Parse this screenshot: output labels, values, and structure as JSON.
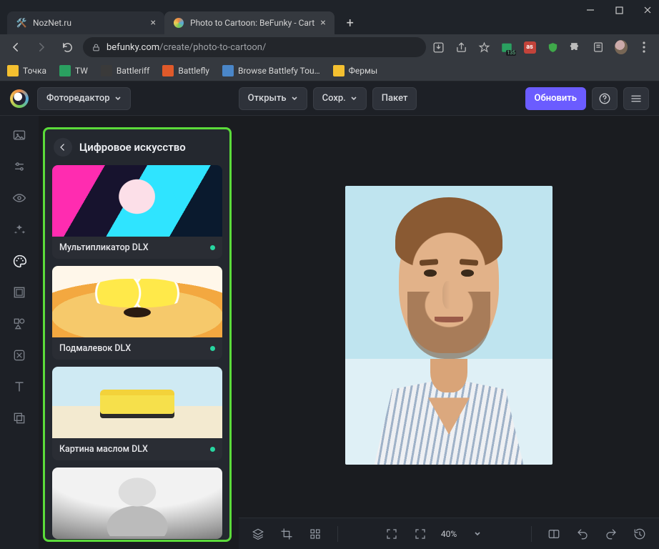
{
  "window": {
    "tabs": [
      {
        "title": "NozNet.ru",
        "active": false
      },
      {
        "title": "Photo to Cartoon: BeFunky - Cart",
        "active": true
      }
    ],
    "url_host": "befunky.com",
    "url_path": "/create/photo-to-cartoon/",
    "bookmarks": [
      {
        "label": "Точка",
        "color": "#f4c030"
      },
      {
        "label": "TW",
        "color": "#2aa060"
      },
      {
        "label": "Battleriff",
        "color": "#c0c0c0"
      },
      {
        "label": "Battlefly",
        "color": "#e05a2a"
      },
      {
        "label": "Browse Battlefy Tou…",
        "color": "#4a86c8"
      },
      {
        "label": "Фермы",
        "color": "#f4c030"
      }
    ],
    "ext_badge": "135"
  },
  "header": {
    "editor_label": "Фоторедактор",
    "open_label": "Открыть",
    "save_label": "Сохр.",
    "batch_label": "Пакет",
    "upgrade_label": "Обновить"
  },
  "panel": {
    "title": "Цифровое искусство",
    "items": [
      {
        "label": "Мультипликатор DLX",
        "has_dot": true
      },
      {
        "label": "Подмалевок DLX",
        "has_dot": true
      },
      {
        "label": "Картина маслом DLX",
        "has_dot": true
      },
      {
        "label": "",
        "has_dot": false
      }
    ]
  },
  "footer": {
    "zoom": "40%"
  }
}
